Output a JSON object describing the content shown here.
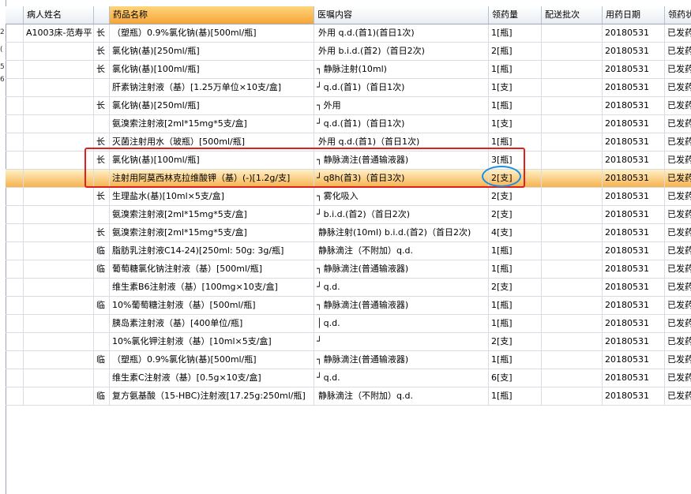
{
  "left_marks": [
    "2",
    "(",
    "5",
    "6"
  ],
  "columns": [
    "",
    "病人姓名",
    "",
    "药品名称",
    "医嘱内容",
    "领药量",
    "配送批次",
    "用药日期",
    "领药状"
  ],
  "rows": [
    {
      "patient": "A1003床-范寿平",
      "type": "长",
      "drug": "（塑瓶）0.9%氯化钠(基)[500ml/瓶]",
      "bracket": "",
      "order": "外用 q.d.(首1)(首日1次)",
      "qty": "1[瓶]",
      "batch": "",
      "date": "20180531",
      "status": "已发药"
    },
    {
      "patient": "",
      "type": "长",
      "drug": "氯化钠(基)[250ml/瓶]",
      "bracket": "",
      "order": "外用 b.i.d.(首2)（首日2次)",
      "qty": "2[瓶]",
      "batch": "",
      "date": "20180531",
      "status": "已发药"
    },
    {
      "patient": "",
      "type": "长",
      "drug": "氯化钠(基)[100ml/瓶]",
      "bracket": "┐",
      "order": "静脉注射(10ml)",
      "qty": "1[瓶]",
      "batch": "",
      "date": "20180531",
      "status": "已发药"
    },
    {
      "patient": "",
      "type": "",
      "drug": "肝素钠注射液（基）[1.25万单位×10支/盒]",
      "bracket": "┘",
      "order": "q.d.(首1)（首日1次)",
      "qty": "1[支]",
      "batch": "",
      "date": "20180531",
      "status": "已发药"
    },
    {
      "patient": "",
      "type": "长",
      "drug": "氯化钠(基)[250ml/瓶]",
      "bracket": "┐",
      "order": "外用",
      "qty": "1[瓶]",
      "batch": "",
      "date": "20180531",
      "status": "已发药"
    },
    {
      "patient": "",
      "type": "",
      "drug": "氨溴索注射液[2ml*15mg*5支/盒]",
      "bracket": "┘",
      "order": "q.d.(首1)（首日1次)",
      "qty": "1[支]",
      "batch": "",
      "date": "20180531",
      "status": "已发药"
    },
    {
      "patient": "",
      "type": "长",
      "drug": "灭菌注射用水（玻瓶）[500ml/瓶]",
      "bracket": "",
      "order": "外用 q.d.(首1)（首日1次)",
      "qty": "1[瓶]",
      "batch": "",
      "date": "20180531",
      "status": "已发药"
    },
    {
      "patient": "",
      "type": "长",
      "drug": "氯化钠(基)[100ml/瓶]",
      "bracket": "┐",
      "order": "静脉滴注(普通输液器)",
      "qty": "3[瓶]",
      "batch": "",
      "date": "20180531",
      "status": "已发药"
    },
    {
      "patient": "",
      "type": "",
      "drug": "注射用阿莫西林克拉维酸钾（基）(-)[1.2g/支]",
      "bracket": "┘",
      "order": "q8h(首3)（首日3次)",
      "qty": "2[支]",
      "batch": "",
      "date": "20180531",
      "status": "已发药"
    },
    {
      "patient": "",
      "type": "长",
      "drug": "生理盐水(基)[10ml×5支/盒]",
      "bracket": "┐",
      "order": "雾化吸入",
      "qty": "2[支]",
      "batch": "",
      "date": "20180531",
      "status": "已发药"
    },
    {
      "patient": "",
      "type": "",
      "drug": "氨溴索注射液[2ml*15mg*5支/盒]",
      "bracket": "┘",
      "order": "b.i.d.(首2)（首日2次)",
      "qty": "2[支]",
      "batch": "",
      "date": "20180531",
      "status": "已发药"
    },
    {
      "patient": "",
      "type": "长",
      "drug": "氨溴索注射液[2ml*15mg*5支/盒]",
      "bracket": "",
      "order": "静脉注射(10ml) b.i.d.(首2)（首日2次)",
      "qty": "4[支]",
      "batch": "",
      "date": "20180531",
      "status": "已发药"
    },
    {
      "patient": "",
      "type": "临",
      "drug": "脂肪乳注射液C14-24)[250ml: 50g: 3g/瓶]",
      "bracket": "",
      "order": "静脉滴注（不附加）q.d.",
      "qty": "1[瓶]",
      "batch": "",
      "date": "20180531",
      "status": "已发药"
    },
    {
      "patient": "",
      "type": "临",
      "drug": "葡萄糖氯化钠注射液（基）[500ml/瓶]",
      "bracket": "┐",
      "order": "静脉滴注(普通输液器)",
      "qty": "1[瓶]",
      "batch": "",
      "date": "20180531",
      "status": "已发药"
    },
    {
      "patient": "",
      "type": "",
      "drug": "维生素B6注射液（基）[100mg×10支/盒]",
      "bracket": "┘",
      "order": "q.d.",
      "qty": "2[支]",
      "batch": "",
      "date": "20180531",
      "status": "已发药"
    },
    {
      "patient": "",
      "type": "临",
      "drug": "10%葡萄糖注射液（基）[500ml/瓶]",
      "bracket": "┐",
      "order": "静脉滴注(普通输液器)",
      "qty": "1[瓶]",
      "batch": "",
      "date": "20180531",
      "status": "已发药"
    },
    {
      "patient": "",
      "type": "",
      "drug": "胰岛素注射液（基）[400单位/瓶]",
      "bracket": "│",
      "order": "q.d.",
      "qty": "1[瓶]",
      "batch": "",
      "date": "20180531",
      "status": "已发药"
    },
    {
      "patient": "",
      "type": "",
      "drug": "10%氯化钾注射液（基）[10ml×5支/盒]",
      "bracket": "┘",
      "order": "",
      "qty": "2[支]",
      "batch": "",
      "date": "20180531",
      "status": "已发药"
    },
    {
      "patient": "",
      "type": "临",
      "drug": "（塑瓶）0.9%氯化钠(基)[500ml/瓶]",
      "bracket": "┐",
      "order": "静脉滴注(普通输液器)",
      "qty": "1[瓶]",
      "batch": "",
      "date": "20180531",
      "status": "已发药"
    },
    {
      "patient": "",
      "type": "",
      "drug": "维生素C注射液（基）[0.5g×10支/盒]",
      "bracket": "┘",
      "order": "q.d.",
      "qty": "6[支]",
      "batch": "",
      "date": "20180531",
      "status": "已发药"
    },
    {
      "patient": "",
      "type": "临",
      "drug": "复方氨基酸（15-HBC)注射液[17.25g:250ml/瓶]",
      "bracket": "",
      "order": "静脉滴注（不附加）q.d.",
      "qty": "1[瓶]",
      "batch": "",
      "date": "20180531",
      "status": "已发药"
    }
  ],
  "selected_row": 8,
  "sorted_column": 3,
  "colors": {
    "highlight_box": "#e0201c",
    "highlight_ellipse": "#1d8fe0",
    "selected_row": "#f6b04a"
  }
}
